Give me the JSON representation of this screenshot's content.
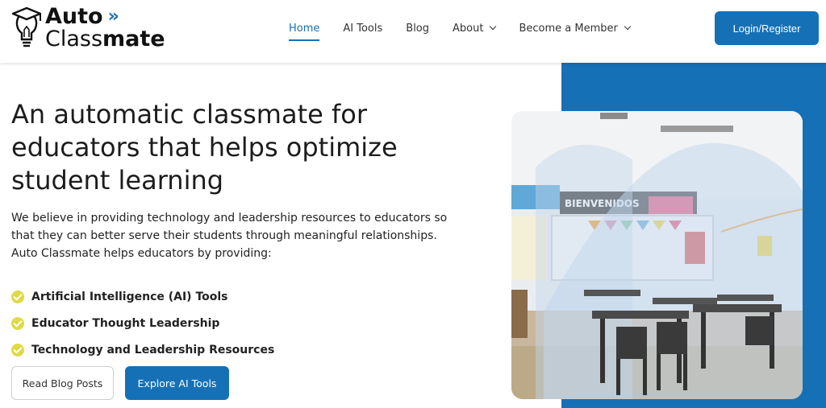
{
  "brand": {
    "line1": "Auto",
    "line2_bold": "mate",
    "line2_light": "Class",
    "chevrons": "»"
  },
  "nav": {
    "items": [
      {
        "label": "Home",
        "active": true
      },
      {
        "label": "AI Tools"
      },
      {
        "label": "Blog"
      },
      {
        "label": "About",
        "dropdown": true
      },
      {
        "label": "Become a Member",
        "dropdown": true
      }
    ],
    "login_label": "Login/Register"
  },
  "hero": {
    "headline": "An automatic classmate for educators that helps optimize student learning",
    "intro": "We believe in providing technology and leadership resources to educators so that they can better serve their students through meaningful relationships. Auto Classmate helps educators by providing:",
    "bullets": [
      "Artificial Intelligence (AI) Tools",
      "Educator Thought Leadership",
      "Technology and Leadership Resources"
    ],
    "secondary_cta": "Read Blog Posts",
    "primary_cta": "Explore AI Tools",
    "image_banner_text": "BIENVENIDOS"
  },
  "colors": {
    "brand_blue": "#1670b6",
    "check_yellow": "#e0d945"
  }
}
